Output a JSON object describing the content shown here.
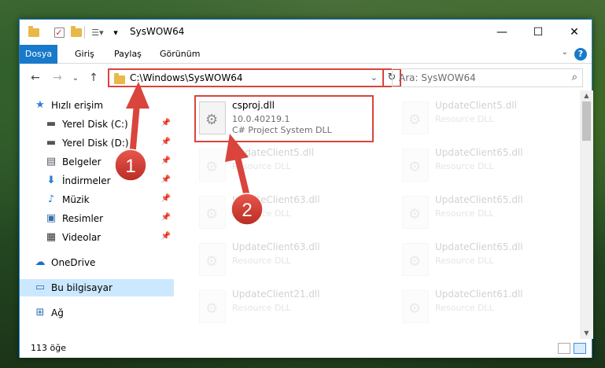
{
  "window": {
    "title": "SysWOW64",
    "controls": {
      "minimize": "—",
      "maximize": "☐",
      "close": "✕"
    }
  },
  "ribbon": {
    "tabs": [
      "Dosya",
      "Giriş",
      "Paylaş",
      "Görünüm"
    ],
    "help": "?"
  },
  "navigation": {
    "back": "←",
    "forward": "→",
    "recent": "⌄",
    "up": "↑",
    "address": "C:\\Windows\\SysWOW64",
    "refresh": "↻",
    "search_placeholder": "Ara: SysWOW64"
  },
  "sidebar": {
    "items": [
      {
        "label": "Hızlı erişim",
        "icon": "star-icon"
      },
      {
        "label": "Yerel Disk (C:)",
        "icon": "drive-icon"
      },
      {
        "label": "Yerel Disk (D:)",
        "icon": "drive-icon"
      },
      {
        "label": "Belgeler",
        "icon": "document-icon"
      },
      {
        "label": "İndirmeler",
        "icon": "download-icon"
      },
      {
        "label": "Müzik",
        "icon": "music-icon"
      },
      {
        "label": "Resimler",
        "icon": "pictures-icon"
      },
      {
        "label": "Videolar",
        "icon": "video-icon"
      },
      {
        "label": "OneDrive",
        "icon": "cloud-icon"
      },
      {
        "label": "Bu bilgisayar",
        "icon": "computer-icon"
      },
      {
        "label": "Ağ",
        "icon": "network-icon"
      }
    ]
  },
  "files": {
    "highlighted": {
      "name": "csproj.dll",
      "version": "10.0.40219.1",
      "description": "C# Project System DLL"
    },
    "faded": [
      {
        "name": "UpdateClient5.dll",
        "type": "Resource DLL"
      },
      {
        "name": "UpdateClient5.dll",
        "type": "Resource DLL"
      },
      {
        "name": "UpdateClient65.dll",
        "type": "Resource DLL"
      },
      {
        "name": "UpdateClient63.dll",
        "type": "Resource DLL"
      },
      {
        "name": "UpdateClient65.dll",
        "type": "Resource DLL"
      },
      {
        "name": "UpdateClient63.dll",
        "type": "Resource DLL"
      },
      {
        "name": "UpdateClient65.dll",
        "type": "Resource DLL"
      },
      {
        "name": "UpdateClient21.dll",
        "type": "Resource DLL"
      },
      {
        "name": "UpdateClient61.dll",
        "type": "Resource DLL"
      }
    ]
  },
  "status": {
    "item_count": "113 öğe"
  },
  "annotations": {
    "step1": "1",
    "step2": "2"
  },
  "colors": {
    "accent": "#1979ca",
    "highlight_red": "#d9443c",
    "selected": "#cce8ff"
  }
}
